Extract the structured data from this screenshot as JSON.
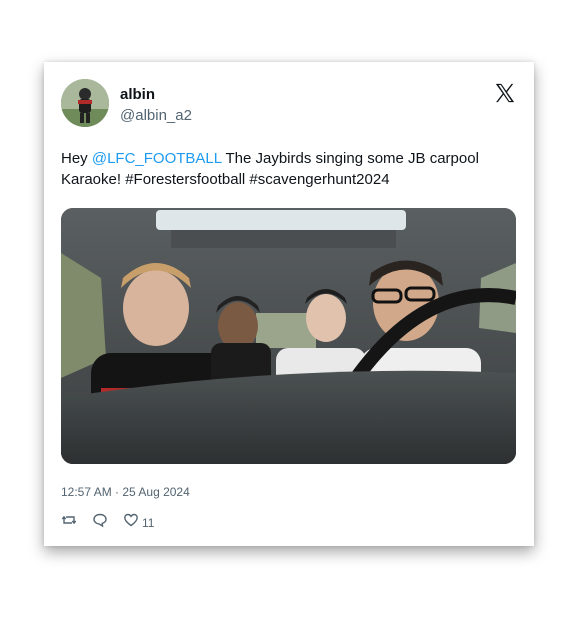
{
  "user": {
    "display_name": "albin",
    "handle": "@albin_a2"
  },
  "tweet": {
    "text_prefix": "Hey ",
    "mention": "@LFC_FOOTBALL",
    "text_rest": " The Jaybirds singing some JB carpool Karaoke! #Forestersfootball #scavengerhunt2024"
  },
  "timestamp": "12:57 AM · 25 Aug 2024",
  "actions": {
    "retweet_icon": "retweet-icon",
    "reply_icon": "reply-icon",
    "like_icon": "heart-icon",
    "like_count": "11"
  },
  "colors": {
    "mention": "#1d9bf0",
    "text": "#0f1419",
    "secondary": "#536471"
  }
}
